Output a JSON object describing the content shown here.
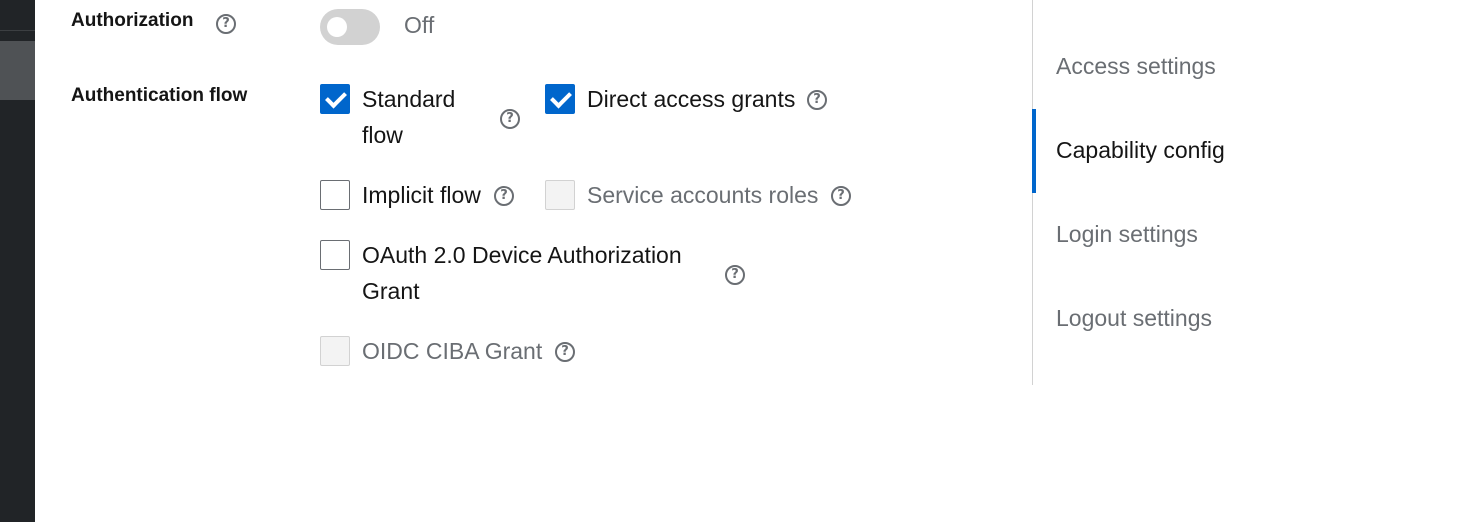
{
  "form": {
    "authorization": {
      "label": "Authorization",
      "help_icon": "question-circle-icon",
      "switch_state": "Off",
      "enabled": false
    },
    "authentication_flow": {
      "label": "Authentication flow",
      "options": [
        {
          "label_line1": "Standard",
          "label_line2": "flow",
          "checked": true,
          "disabled": false
        },
        {
          "label": "Direct access grants",
          "checked": true,
          "disabled": false
        },
        {
          "label": "Implicit flow",
          "checked": false,
          "disabled": false
        },
        {
          "label": "Service accounts roles",
          "checked": false,
          "disabled": true
        },
        {
          "label_line1": "OAuth 2.0 Device Authorization",
          "label_line2": "Grant",
          "checked": false,
          "disabled": false
        },
        {
          "label": "OIDC CIBA Grant",
          "checked": false,
          "disabled": true
        }
      ]
    }
  },
  "jump_links": {
    "items": [
      "Access settings",
      "Capability config",
      "Login settings",
      "Logout settings"
    ],
    "active": "Capability config"
  },
  "colors": {
    "primary": "#0066cc",
    "sidebar": "#212427",
    "muted_text": "#6a6e73"
  }
}
